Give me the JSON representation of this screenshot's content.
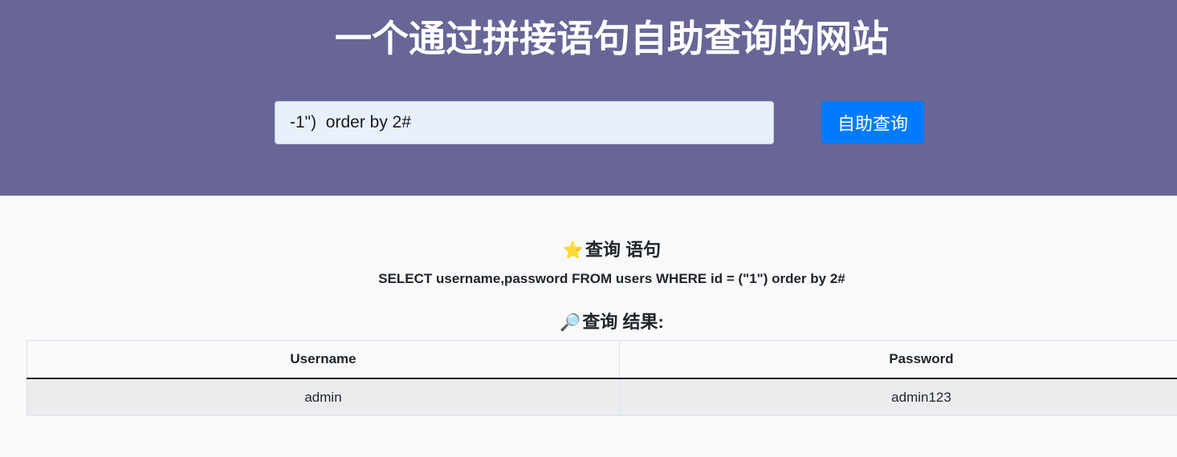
{
  "header": {
    "title": "一个通过拼接语句自助查询的网站",
    "search": {
      "value": "-1\")  order by 2#",
      "placeholder": ""
    },
    "button_label": "自助查询"
  },
  "sql_section": {
    "icon": "star-icon",
    "icon_glyph": "⭐",
    "title": "查询 语句",
    "statement": "SELECT username,password FROM users WHERE id = (\"1\") order by 2#"
  },
  "result_section": {
    "icon": "magnifier-icon",
    "icon_glyph": "🔎",
    "title": "查询 结果:"
  },
  "table": {
    "columns": [
      "Username",
      "Password"
    ],
    "rows": [
      [
        "admin",
        "admin123"
      ]
    ]
  },
  "colors": {
    "header_bg": "#676697",
    "button_bg": "#007bff",
    "input_bg": "#e8f0fe",
    "page_bg": "#f8f9fa"
  }
}
